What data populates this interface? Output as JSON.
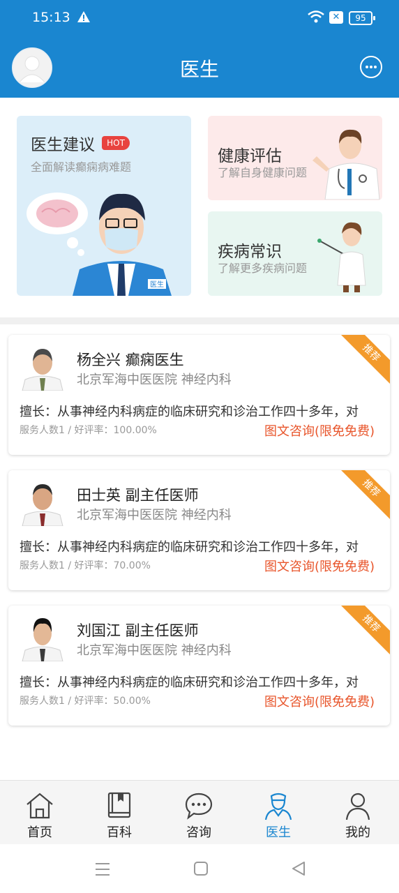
{
  "status": {
    "time": "15:13",
    "battery": "95"
  },
  "header": {
    "title": "医生",
    "avatar_icon": "user-avatar-icon",
    "more_icon": "more-options-icon"
  },
  "features": [
    {
      "title": "医生建议",
      "badge": "HOT",
      "subtitle": "全面解读癫痫病难题"
    },
    {
      "title": "健康评估",
      "subtitle": "了解自身健康问题"
    },
    {
      "title": "疾病常识",
      "subtitle": "了解更多疾病问题"
    }
  ],
  "doctors": [
    {
      "name": "杨全兴  癫痫医生",
      "hospital": "北京军海中医医院  神经内科",
      "specialty": "擅长：从事神经内科病症的临床研究和诊治工作四十多年，对",
      "stats": "服务人数1  /  好评率：100.00%",
      "consult": "图文咨询(限免免费)",
      "ribbon": "推荐"
    },
    {
      "name": "田士英  副主任医师",
      "hospital": "北京军海中医医院  神经内科",
      "specialty": "擅长：从事神经内科病症的临床研究和诊治工作四十多年，对",
      "stats": "服务人数1  /  好评率：70.00%",
      "consult": "图文咨询(限免免费)",
      "ribbon": "推荐"
    },
    {
      "name": "刘国江  副主任医师",
      "hospital": "北京军海中医医院  神经内科",
      "specialty": "擅长：从事神经内科病症的临床研究和诊治工作四十多年，对",
      "stats": "服务人数1  /  好评率：50.00%",
      "consult": "图文咨询(限免免费)",
      "ribbon": "推荐"
    }
  ],
  "tabs": [
    {
      "label": "首页",
      "icon": "home-icon"
    },
    {
      "label": "百科",
      "icon": "book-icon"
    },
    {
      "label": "咨询",
      "icon": "chat-icon"
    },
    {
      "label": "医生",
      "icon": "doctor-icon",
      "active": true
    },
    {
      "label": "我的",
      "icon": "profile-icon"
    }
  ],
  "colors": {
    "primary": "#1a86d0",
    "accent": "#e8552b",
    "ribbon": "#f39a2b"
  }
}
